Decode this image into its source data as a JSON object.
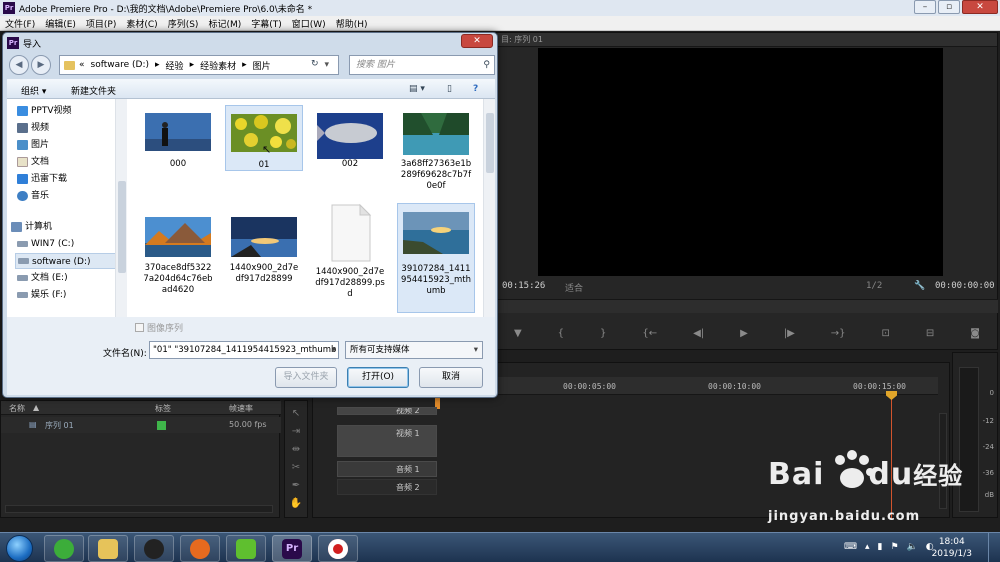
{
  "window": {
    "title": "Adobe Premiere Pro - D:\\我的文档\\Adobe\\Premiere Pro\\6.0\\未命名 *",
    "app_icon": "Pr"
  },
  "menu": [
    "文件(F)",
    "编辑(E)",
    "项目(P)",
    "素材(C)",
    "序列(S)",
    "标记(M)",
    "字幕(T)",
    "窗口(W)",
    "帮助(H)"
  ],
  "program_monitor": {
    "tab": "目: 序列 01",
    "timecode_left": "00:15:26",
    "fit": "适合",
    "page": "1/2",
    "timecode_right": "00:00:00:00"
  },
  "timeline": {
    "ruler": [
      "00:00:05:00",
      "00:00:10:00",
      "00:00:15:00"
    ],
    "tracks": [
      {
        "name": "视频 2",
        "kind": "video"
      },
      {
        "name": "视频 1",
        "kind": "video"
      },
      {
        "name": "音频 1",
        "kind": "audio"
      },
      {
        "name": "音频 2",
        "kind": "audio"
      }
    ]
  },
  "vu_meter": {
    "ticks": [
      "0",
      "-12",
      "-24",
      "-36",
      "dB"
    ]
  },
  "project_panel": {
    "columns": {
      "name": "名称",
      "label": "标签",
      "fps": "帧速率"
    },
    "rows": [
      {
        "name": "序列 01",
        "fps": "50.00 fps",
        "label_color": "#3fb54a"
      }
    ]
  },
  "dialog": {
    "title": "导入",
    "close": "✕",
    "address": [
      "«",
      "software (D:)",
      "▸",
      "经验",
      "▸",
      "经验素材",
      "▸",
      "图片"
    ],
    "search_placeholder": "搜索 图片",
    "toolbar": {
      "organize": "组织 ▾",
      "new_folder": "新建文件夹"
    },
    "sidebar": [
      {
        "label": "PPTV视频",
        "icon": "pptv-icon"
      },
      {
        "label": "视频",
        "icon": "video-library-icon"
      },
      {
        "label": "图片",
        "icon": "pictures-library-icon"
      },
      {
        "label": "文档",
        "icon": "documents-library-icon"
      },
      {
        "label": "迅雷下载",
        "icon": "thunder-download-icon"
      },
      {
        "label": "音乐",
        "icon": "music-library-icon"
      },
      {
        "label": "计算机",
        "icon": "computer-icon"
      },
      {
        "label": "WIN7 (C:)",
        "icon": "drive-icon"
      },
      {
        "label": "software (D:)",
        "icon": "drive-icon"
      },
      {
        "label": "文档 (E:)",
        "icon": "drive-icon"
      },
      {
        "label": "娱乐 (F:)",
        "icon": "drive-icon"
      }
    ],
    "files": [
      {
        "label": "000",
        "thumb": "person"
      },
      {
        "label": "01",
        "thumb": "flowers"
      },
      {
        "label": "002",
        "thumb": "fish"
      },
      {
        "label": "3a68ff27363e1b289f69628c7b7f0e0f",
        "thumb": "lake"
      },
      {
        "label": "370ace8df53227a204d64c76ebad4620",
        "thumb": "autumn"
      },
      {
        "label": "1440x900_2d7edf917d28899",
        "thumb": "sunset"
      },
      {
        "label": "1440x900_2d7edf917d28899.psd",
        "thumb": "blank"
      },
      {
        "label": "39107284_1411954415923_mthumb",
        "thumb": "coast"
      }
    ],
    "image_sequence": "图像序列",
    "filename_label": "文件名(N):",
    "filename_value": "\"01\" \"39107284_1411954415923_mthumb",
    "filter": "所有可支持媒体",
    "buttons": {
      "import_folder": "导入文件夹",
      "open": "打开(O)",
      "cancel": "取消"
    }
  },
  "taskbar": {
    "time": "18:04",
    "date": "2019/1/3"
  },
  "watermark": {
    "brand": "Bai",
    "brand2": "du",
    "suffix": "经验",
    "url": "jingyan.baidu.com"
  }
}
